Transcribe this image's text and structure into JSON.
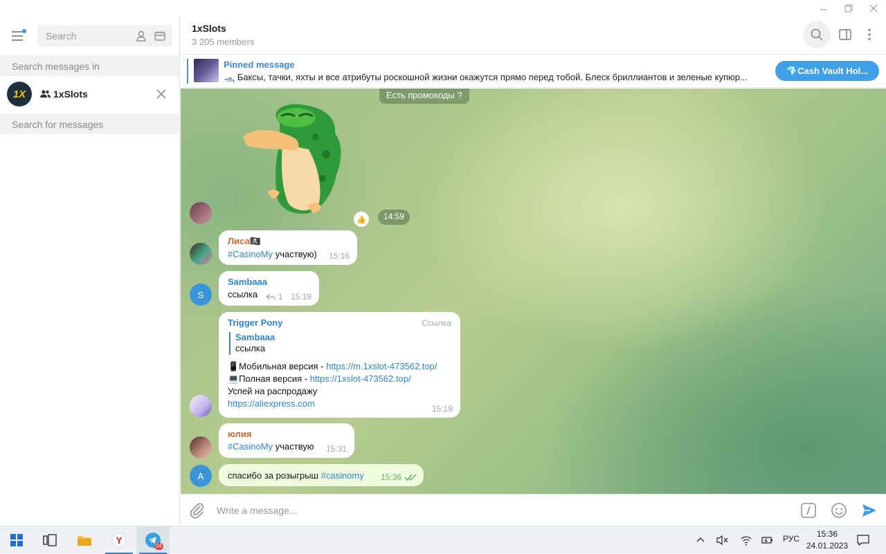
{
  "window": {
    "minimize_icon": "minimize-icon",
    "restore_icon": "restore-icon",
    "close_icon": "close-icon"
  },
  "sidebar": {
    "search_placeholder": "Search",
    "search_messages_in": "Search messages in",
    "chat_name": "1xSlots",
    "chat_avatar_text": "1X",
    "search_for_messages": "Search for messages"
  },
  "header": {
    "title": "1xSlots",
    "subtitle": "3 205 members"
  },
  "pinned": {
    "title": "Pinned message",
    "text": "🛥️ Баксы, тачки, яхты и все атрибуты роскошной жизни окажутся прямо перед тобой. Блеск бриллиантов и зеленые купюр...",
    "button": "💎Cash Vault Hol..."
  },
  "chat": {
    "service_message": "Есть промокоды ?",
    "sticker_reaction": "👍",
    "sticker_time": "14:59",
    "messages": [
      {
        "name": "Лиса🏴‍☠️",
        "hashtag": "#CasinoMy",
        "text": " участвую)",
        "time": "15:16",
        "name_color": "#d0672a"
      },
      {
        "name": "Sambaaa",
        "text": "ссылка",
        "replies": "1",
        "time": "15:19",
        "avatar_letter": "S",
        "name_color": "#2b86d6"
      },
      {
        "name": "Trigger Pony",
        "badge": "Ссылка",
        "reply_name": "Sambaaa",
        "reply_text": "ссылка",
        "line1_prefix": "📱Мобильная версия  - ",
        "line1_link": "https://m.1xslot-473562.top/",
        "line2_prefix": "💻Полная версия - ",
        "line2_link": "https://1xslot-473562.top/",
        "line3": "Успей на распродажу",
        "line4_link": "https://aliexpress.com",
        "time": "15:19",
        "name_color": "#2b86d6"
      },
      {
        "name": "юлия",
        "hashtag": "#CasinoMy",
        "text": " участвую",
        "time": "15:31",
        "name_color": "#d0672a"
      },
      {
        "text": "спасибо за розыгрыш ",
        "hashtag": "#casinomy",
        "time": "15:36",
        "avatar_letter": "A"
      }
    ]
  },
  "input": {
    "placeholder": "Write a message..."
  },
  "taskbar": {
    "telegram_badge": "04",
    "language": "РУС",
    "time": "15:36",
    "date": "24.01.2023"
  }
}
